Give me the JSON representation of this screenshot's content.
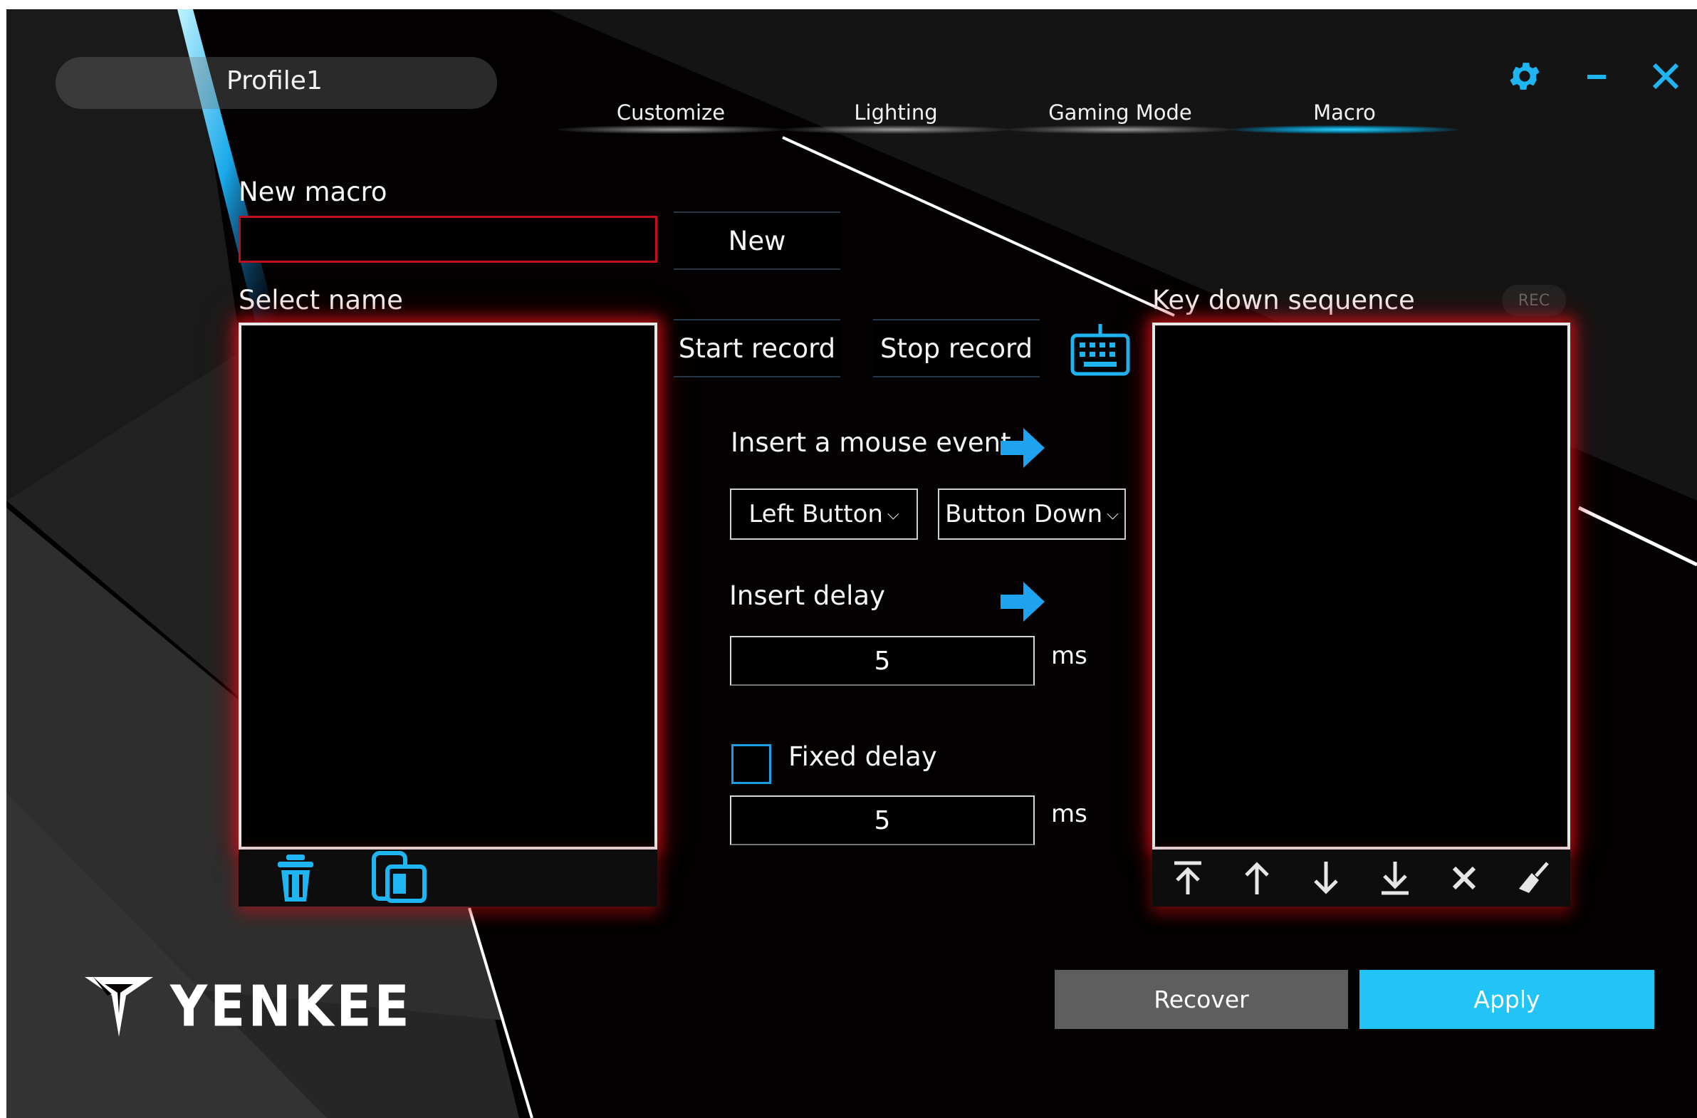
{
  "profile": {
    "name": "Profile1"
  },
  "tabs": [
    {
      "label": "Customize",
      "active": false
    },
    {
      "label": "Lighting",
      "active": false
    },
    {
      "label": "Gaming Mode",
      "active": false
    },
    {
      "label": "Macro",
      "active": true
    }
  ],
  "window_controls": {
    "settings_icon": "gear-icon",
    "minimize_icon": "minimize-icon",
    "close_icon": "close-icon"
  },
  "new_macro": {
    "label": "New macro",
    "value": "",
    "button": "New"
  },
  "select_name": {
    "label": "Select name",
    "items": [],
    "toolbar": [
      "trash-icon",
      "copy-icon"
    ]
  },
  "record": {
    "start": "Start record",
    "stop": "Stop record",
    "keyboard_icon": "keyboard-icon"
  },
  "mouse_event": {
    "label": "Insert a mouse event",
    "button_select": "Left Button",
    "action_select": "Button Down"
  },
  "delay": {
    "label": "Insert delay",
    "value": "5",
    "unit": "ms"
  },
  "fixed_delay": {
    "label": "Fixed delay",
    "checked": false,
    "value": "5",
    "unit": "ms"
  },
  "sequence": {
    "label": "Key down sequence",
    "rec_badge": "REC",
    "items": [],
    "toolbar": [
      "move-top-icon",
      "move-up-icon",
      "move-down-icon",
      "move-bottom-icon",
      "delete-icon",
      "clear-icon"
    ]
  },
  "actions": {
    "recover": "Recover",
    "apply": "Apply"
  },
  "brand": {
    "name": "YENKEE"
  },
  "colors": {
    "accent_blue": "#22c3f5",
    "glow_red": "#c0101b",
    "background": "#030101"
  }
}
